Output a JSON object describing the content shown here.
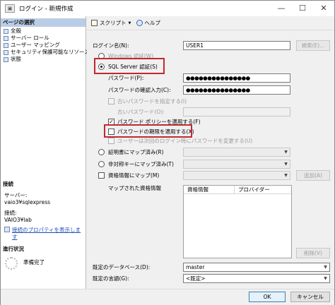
{
  "window": {
    "title": "ログイン - 新規作成",
    "minimize": "—",
    "maximize": "☐",
    "close": "✕"
  },
  "left_panel": {
    "pages_header": "ページの選択",
    "pages": [
      "全般",
      "サーバー ロール",
      "ユーザー マッピング",
      "セキュリティ保護可能なリソース",
      "状態"
    ],
    "connection_header": "接続",
    "server_label": "サーバー:",
    "server_value": "vaio3¥sqlexpress",
    "connection_label": "接続:",
    "connection_value": "VAIO3¥lab",
    "view_properties_link": "接続のプロパティを表示しま\nす",
    "progress_header": "進行状況",
    "progress_status": "準備完了"
  },
  "toolbar": {
    "script_label": "スクリプト",
    "script_arrow": "▼",
    "help_label": "ヘルプ"
  },
  "form": {
    "login_name_label": "ログイン名(N):",
    "login_name_value": "USER1",
    "search_button": "検索(E)...",
    "windows_auth_label": "Windows 認証(W)",
    "sql_auth_label": "SQL Server 認証(S)",
    "password_label": "パスワード(P):",
    "password_value": "●●●●●●●●●●●●●●●",
    "confirm_password_label": "パスワードの確認入力(C):",
    "confirm_password_value": "●●●●●●●●●●●●●●●",
    "specify_old_password_label": "古いパスワードを指定する(I)",
    "old_password_label": "古いパスワード(O):",
    "enforce_policy_label": "パスワード ポリシーを適用する(F)",
    "enforce_expiration_label": "パスワードの期限を適用する(X)",
    "must_change_label": "ユーザーは次回のログイン時にパスワードを変更する(U)",
    "cert_mapped_label": "証明書にマップ済み(R)",
    "asym_key_mapped_label": "非対称キーにマップ済み(T)",
    "map_credential_label": "資格情報にマップ(M)",
    "add_button": "追加(A)",
    "mapped_credentials_label": "マップされた資格情報",
    "grid_col_credential": "資格情報",
    "grid_col_provider": "プロバイダー",
    "remove_button": "削除(V)",
    "default_db_label": "既定のデータベース(D):",
    "default_db_value": "master",
    "default_lang_label": "既定の言語(G):",
    "default_lang_value": "<既定>",
    "ok_button": "OK",
    "cancel_button": "キャンセル",
    "checkmark": "✓",
    "dropdown_arrow": "▼"
  },
  "accent": {
    "highlight_box": "#c0292e",
    "section_header": "#b9cde6"
  }
}
